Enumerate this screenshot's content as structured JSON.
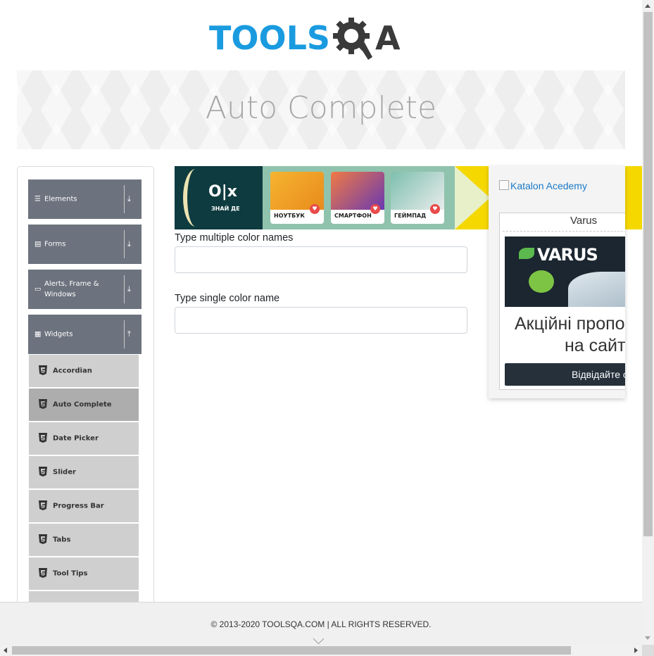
{
  "header": {
    "logo_part1": "TOOLS",
    "logo_part2": "A",
    "logo_alt": "TOOLSQA"
  },
  "banner": {
    "title": "Auto Complete"
  },
  "sidebar": {
    "groups": [
      {
        "label": "Elements",
        "icon": "hamburger-icon",
        "state": "collapsed"
      },
      {
        "label": "Forms",
        "icon": "document-icon",
        "state": "collapsed"
      },
      {
        "label": "Alerts, Frame & Windows",
        "icon": "window-icon",
        "state": "collapsed"
      },
      {
        "label": "Widgets",
        "icon": "grid-icon",
        "state": "expanded"
      }
    ],
    "items": [
      {
        "label": "Accordian"
      },
      {
        "label": "Auto Complete",
        "active": true
      },
      {
        "label": "Date Picker"
      },
      {
        "label": "Slider"
      },
      {
        "label": "Progress Bar"
      },
      {
        "label": "Tabs"
      },
      {
        "label": "Tool Tips"
      }
    ]
  },
  "ad_banner": {
    "brand": "O|x",
    "tagline": "ЗНАЙ ДЕ",
    "cards": [
      {
        "label": "НОУТБУК"
      },
      {
        "label": "СМАРТФОН"
      },
      {
        "label": "ГЕЙМПАД"
      }
    ]
  },
  "side_ad": {
    "image_alt": "Katalon Acedemy",
    "sponsor": "Varus",
    "logo": "VARUS",
    "headline_line1": "Акційні пропо",
    "headline_line2": "на сайті",
    "button": "Відвідайте сайт"
  },
  "form": {
    "multiple_label": "Type multiple color names",
    "multiple_value": "",
    "single_label": "Type single color name",
    "single_value": ""
  },
  "footer": {
    "text": "© 2013-2020 TOOLSQA.COM | ALL RIGHTS RESERVED."
  },
  "colors": {
    "brand_blue": "#1a9be0",
    "sidebar_group": "#6c737e",
    "sidebar_item": "#cfcfcf",
    "sidebar_item_active": "#adadad"
  }
}
